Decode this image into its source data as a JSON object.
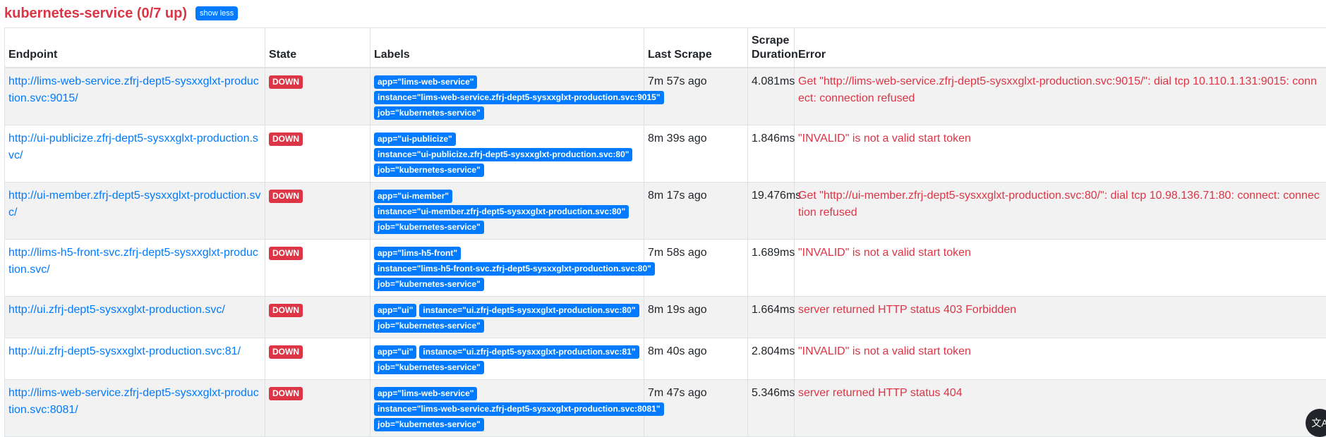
{
  "header": {
    "title": "kubernetes-service (0/7 up)",
    "toggle_label": "show less"
  },
  "table": {
    "columns": [
      "Endpoint",
      "State",
      "Labels",
      "Last Scrape",
      "Scrape Duration",
      "Error"
    ],
    "rows": [
      {
        "endpoint": "http://lims-web-service.zfrj-dept5-sysxxglxt-production.svc:9015/",
        "state": "DOWN",
        "labels": [
          "app=\"lims-web-service\"",
          "instance=\"lims-web-service.zfrj-dept5-sysxxglxt-production.svc:9015\"",
          "job=\"kubernetes-service\""
        ],
        "last_scrape": "7m 57s ago",
        "duration": "4.081ms",
        "error": "Get \"http://lims-web-service.zfrj-dept5-sysxxglxt-production.svc:9015/\": dial tcp 10.110.1.131:9015: connect: connection refused"
      },
      {
        "endpoint": "http://ui-publicize.zfrj-dept5-sysxxglxt-production.svc/",
        "state": "DOWN",
        "labels": [
          "app=\"ui-publicize\"",
          "instance=\"ui-publicize.zfrj-dept5-sysxxglxt-production.svc:80\"",
          "job=\"kubernetes-service\""
        ],
        "last_scrape": "8m 39s ago",
        "duration": "1.846ms",
        "error": "\"INVALID\" is not a valid start token"
      },
      {
        "endpoint": "http://ui-member.zfrj-dept5-sysxxglxt-production.svc/",
        "state": "DOWN",
        "labels": [
          "app=\"ui-member\"",
          "instance=\"ui-member.zfrj-dept5-sysxxglxt-production.svc:80\"",
          "job=\"kubernetes-service\""
        ],
        "last_scrape": "8m 17s ago",
        "duration": "19.476ms",
        "error": "Get \"http://ui-member.zfrj-dept5-sysxxglxt-production.svc:80/\": dial tcp 10.98.136.71:80: connect: connection refused"
      },
      {
        "endpoint": "http://lims-h5-front-svc.zfrj-dept5-sysxxglxt-production.svc/",
        "state": "DOWN",
        "labels": [
          "app=\"lims-h5-front\"",
          "instance=\"lims-h5-front-svc.zfrj-dept5-sysxxglxt-production.svc:80\"",
          "job=\"kubernetes-service\""
        ],
        "last_scrape": "7m 58s ago",
        "duration": "1.689ms",
        "error": "\"INVALID\" is not a valid start token"
      },
      {
        "endpoint": "http://ui.zfrj-dept5-sysxxglxt-production.svc/",
        "state": "DOWN",
        "labels": [
          "app=\"ui\"",
          "instance=\"ui.zfrj-dept5-sysxxglxt-production.svc:80\"",
          "job=\"kubernetes-service\""
        ],
        "last_scrape": "8m 19s ago",
        "duration": "1.664ms",
        "error": "server returned HTTP status 403 Forbidden"
      },
      {
        "endpoint": "http://ui.zfrj-dept5-sysxxglxt-production.svc:81/",
        "state": "DOWN",
        "labels": [
          "app=\"ui\"",
          "instance=\"ui.zfrj-dept5-sysxxglxt-production.svc:81\"",
          "job=\"kubernetes-service\""
        ],
        "last_scrape": "8m 40s ago",
        "duration": "2.804ms",
        "error": "\"INVALID\" is not a valid start token"
      },
      {
        "endpoint": "http://lims-web-service.zfrj-dept5-sysxxglxt-production.svc:8081/",
        "state": "DOWN",
        "labels": [
          "app=\"lims-web-service\"",
          "instance=\"lims-web-service.zfrj-dept5-sysxxglxt-production.svc:8081\"",
          "job=\"kubernetes-service\""
        ],
        "last_scrape": "7m 47s ago",
        "duration": "5.346ms",
        "error": "server returned HTTP status 404"
      }
    ]
  },
  "floating_button": {
    "icon": "translate-icon",
    "glyph": "文A"
  },
  "colors": {
    "danger": "#dc3545",
    "primary": "#007bff",
    "stripe": "#f2f2f2",
    "border": "#dee2e6"
  }
}
